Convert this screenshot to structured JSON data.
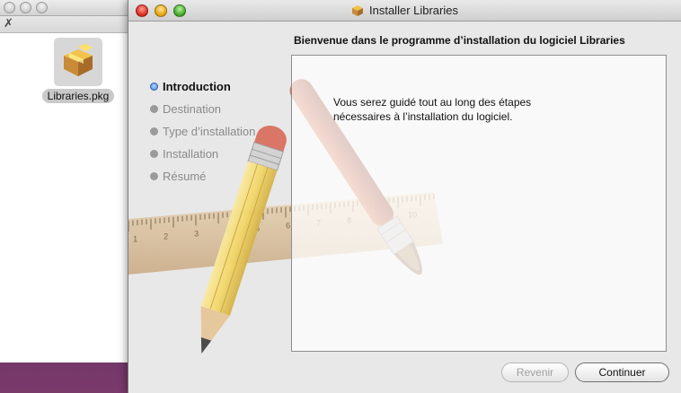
{
  "finder": {
    "file_label": "Libraries.pkg",
    "toolbar_icon": "wrench-icon"
  },
  "installer": {
    "title": "Installer Libraries",
    "heading": "Bienvenue dans le programme d’installation du logiciel Libraries",
    "body_line1": "Vous serez guidé tout au long des étapes",
    "body_line2": "nécessaires à l’installation du logiciel.",
    "steps": [
      {
        "label": "Introduction",
        "active": true
      },
      {
        "label": "Destination",
        "active": false
      },
      {
        "label": "Type d’installation",
        "active": false
      },
      {
        "label": "Installation",
        "active": false
      },
      {
        "label": "Résumé",
        "active": false
      }
    ],
    "buttons": {
      "back": "Revenir",
      "continue": "Continuer"
    },
    "ruler_ticks": [
      "1",
      "2",
      "3",
      "4",
      "5",
      "6",
      "7",
      "8",
      "9",
      "10"
    ]
  },
  "colors": {
    "active_step": "#3f7ee0",
    "pencil_body": "#f4d86a",
    "brush_handle": "#b5563a"
  }
}
